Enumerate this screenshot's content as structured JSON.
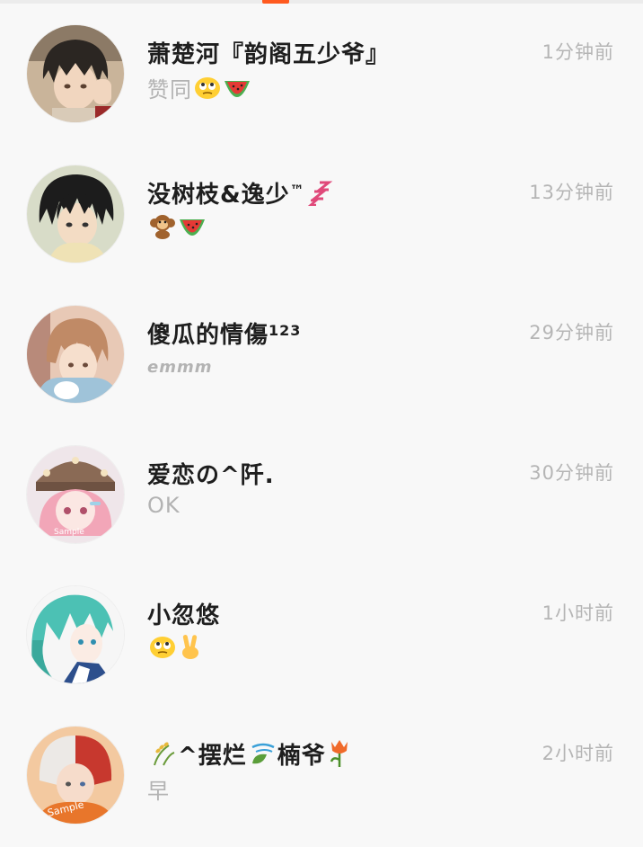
{
  "conversations": [
    {
      "name": "萧楚河『韵阁五少爷』",
      "message": "赞同",
      "time": "1分钟前",
      "avatar": "avatar-1",
      "message_icons": [
        "eyeroll-emoji-icon",
        "watermelon-icon"
      ],
      "name_icons": []
    },
    {
      "name": "没树枝&逸少",
      "name_suffix": "™",
      "message": "",
      "time": "13分钟前",
      "avatar": "avatar-2",
      "message_icons": [
        "monkey-icon",
        "watermelon-icon"
      ],
      "name_icons": [
        "sleep-zzz-icon"
      ]
    },
    {
      "name": "傻瓜的情傷",
      "name_suffix": "123",
      "message": "emmm",
      "time": "29分钟前",
      "avatar": "avatar-3",
      "message_icons": [],
      "name_icons": []
    },
    {
      "name": "爱恋の^阡.",
      "message": "OK",
      "time": "30分钟前",
      "avatar": "avatar-4",
      "message_icons": [],
      "name_icons": []
    },
    {
      "name": "小忽悠",
      "message": "",
      "time": "1小时前",
      "avatar": "avatar-5",
      "message_icons": [
        "eyeroll-emoji-icon",
        "victory-hand-icon"
      ],
      "name_icons": []
    },
    {
      "name": "^摆烂",
      "name_middle": "楠爷",
      "message": "早",
      "time": "2小时前",
      "avatar": "avatar-6",
      "message_icons": [],
      "name_icons": [
        "rice-icon",
        "leaf-wind-icon",
        "tulip-icon"
      ]
    }
  ],
  "avatar_watermark": "Sample",
  "colors": {
    "accent": "#ff5a1f",
    "name": "#1e1e1e",
    "muted": "#b3b3b3",
    "background": "#f8f8f8"
  }
}
